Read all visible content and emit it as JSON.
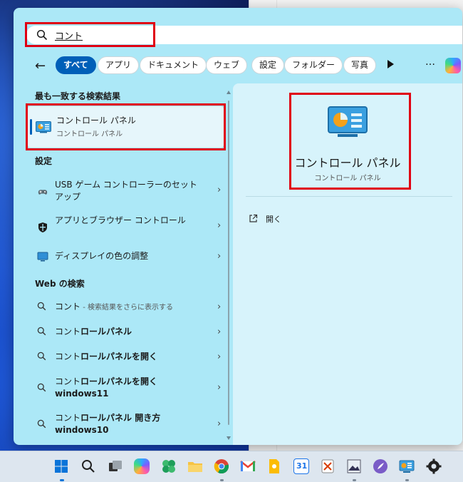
{
  "search": {
    "query": "コント"
  },
  "filters": {
    "back_label": "←",
    "chips": [
      "すべて",
      "アプリ",
      "ドキュメント",
      "ウェブ",
      "設定",
      "フォルダー",
      "写真"
    ],
    "more_label": "…"
  },
  "best_match": {
    "heading": "最も一致する検索結果",
    "title": "コントロール パネル",
    "subtitle": "コントロール パネル"
  },
  "settings_section": {
    "heading": "設定",
    "items": [
      {
        "label": "USB ゲーム コントローラーのセットアップ",
        "icon": "gamepad-icon"
      },
      {
        "label": "アプリとブラウザー コントロール",
        "icon": "shield-icon"
      },
      {
        "label": "ディスプレイの色の調整",
        "icon": "monitor-icon"
      }
    ]
  },
  "web_section": {
    "heading": "Web の検索",
    "items": [
      {
        "label": "コント",
        "note": " - 検索結果をさらに表示する"
      },
      {
        "label_prefix": "コント",
        "label_bold": "ロールパネル",
        "note": ""
      },
      {
        "label_prefix": "コント",
        "label_bold": "ロールパネルを開く",
        "note": ""
      },
      {
        "label_prefix": "コント",
        "label_bold": "ロールパネルを開く",
        "line2": "windows11"
      },
      {
        "label_prefix": "コント",
        "label_bold": "ロールパネル 開き方",
        "line2": "windows10"
      }
    ]
  },
  "preview": {
    "title": "コントロール パネル",
    "subtitle": "コントロール パネル",
    "open_label": "開く"
  },
  "taskbar": {
    "icons": [
      "start-icon",
      "search-icon",
      "task-view-icon",
      "copilot-icon",
      "widgets-icon",
      "file-explorer-icon",
      "chrome-icon",
      "gmail-icon",
      "keep-icon",
      "calendar-icon",
      "snipping-tool-icon",
      "photos-editor-icon",
      "paint-icon",
      "control-panel-icon",
      "settings-icon"
    ],
    "calendar_date": "31"
  },
  "colors": {
    "accent": "#005fb8",
    "highlight": "#e00012",
    "panel_bg": "#ace8f7"
  }
}
